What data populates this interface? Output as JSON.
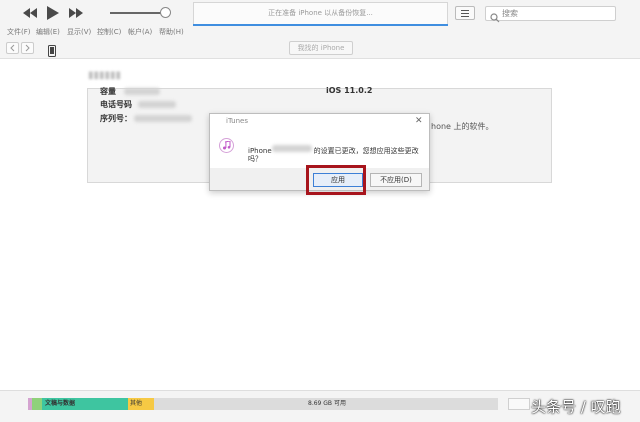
{
  "toolbar": {
    "status": "正在准备 iPhone 以从备份恢复...",
    "search_placeholder": "搜索",
    "icons": [
      "rewind-icon",
      "play-icon",
      "fast-forward-icon",
      "list-icon",
      "search-icon"
    ]
  },
  "menu": [
    "文件(F)",
    "编辑(E)",
    "显示(V)",
    "控制(C)",
    "帐户(A)",
    "帮助(H)"
  ],
  "nav": {
    "device_pill": "我找的 iPhone"
  },
  "summary": {
    "capacity_label": "容量",
    "phone_label": "电话号码",
    "serial_label": "序列号：",
    "ios_version": "iOS 11.0.2",
    "ios_note": "hone 上的软件。"
  },
  "dialog": {
    "title": "iTunes",
    "close": "✕",
    "message_prefix": "iPhone",
    "message_line1_suffix": "的设置已更改，您想应用这些更改",
    "message_line2": "吗？",
    "apply_label": "应用",
    "noapply_label": "不应用(D)"
  },
  "storage": {
    "seg_docs_label": "文稿与数据",
    "seg_other_label": "其他",
    "free_label": "8.69 GB 可用",
    "colors": {
      "pink": "#d4a3d0",
      "green": "#8fd17a",
      "teal": "#3ec5a0",
      "yellow": "#f6c944"
    }
  },
  "watermark": "头条号 / 叹跑",
  "colors": {
    "accent_blue": "#3f8ee0",
    "highlight_red": "#a7141c"
  }
}
